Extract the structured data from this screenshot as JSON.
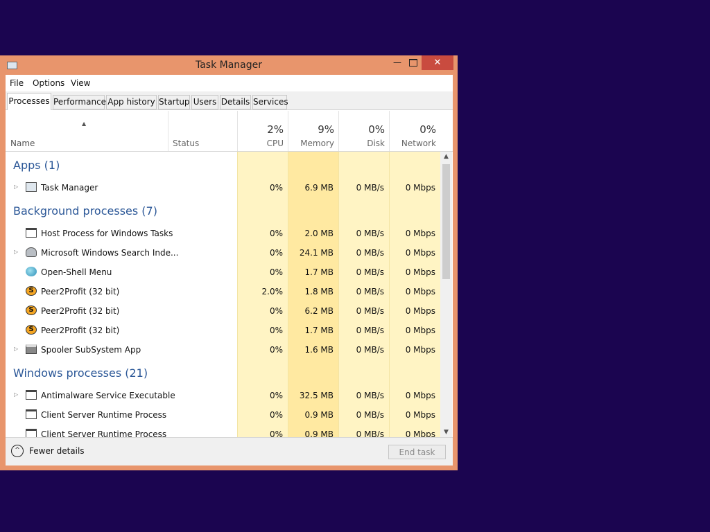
{
  "window": {
    "title": "Task Manager"
  },
  "menu": [
    "File",
    "Options",
    "View"
  ],
  "tabs": [
    "Processes",
    "Performance",
    "App history",
    "Startup",
    "Users",
    "Details",
    "Services"
  ],
  "columns": {
    "name": "Name",
    "status": "Status",
    "cpu": {
      "pct": "2%",
      "label": "CPU"
    },
    "memory": {
      "pct": "9%",
      "label": "Memory"
    },
    "disk": {
      "pct": "0%",
      "label": "Disk"
    },
    "network": {
      "pct": "0%",
      "label": "Network"
    }
  },
  "groups": [
    {
      "title": "Apps (1)",
      "rows": [
        {
          "name": "Task Manager",
          "icon": "task-manager-icon",
          "expandable": true,
          "cpu": "0%",
          "memory": "6.9 MB",
          "disk": "0 MB/s",
          "network": "0 Mbps"
        }
      ]
    },
    {
      "title": "Background processes (7)",
      "rows": [
        {
          "name": "Host Process for Windows Tasks",
          "icon": "window-icon",
          "expandable": false,
          "cpu": "0%",
          "memory": "2.0 MB",
          "disk": "0 MB/s",
          "network": "0 Mbps"
        },
        {
          "name": "Microsoft Windows Search Inde...",
          "icon": "search-indexer-icon",
          "expandable": true,
          "cpu": "0%",
          "memory": "24.1 MB",
          "disk": "0 MB/s",
          "network": "0 Mbps"
        },
        {
          "name": "Open-Shell Menu",
          "icon": "shell-icon",
          "expandable": false,
          "cpu": "0%",
          "memory": "1.7 MB",
          "disk": "0 MB/s",
          "network": "0 Mbps"
        },
        {
          "name": "Peer2Profit (32 bit)",
          "icon": "peer2profit-icon",
          "expandable": false,
          "cpu": "2.0%",
          "memory": "1.8 MB",
          "disk": "0 MB/s",
          "network": "0 Mbps"
        },
        {
          "name": "Peer2Profit (32 bit)",
          "icon": "peer2profit-icon",
          "expandable": false,
          "cpu": "0%",
          "memory": "6.2 MB",
          "disk": "0 MB/s",
          "network": "0 Mbps"
        },
        {
          "name": "Peer2Profit (32 bit)",
          "icon": "peer2profit-icon",
          "expandable": false,
          "cpu": "0%",
          "memory": "1.7 MB",
          "disk": "0 MB/s",
          "network": "0 Mbps"
        },
        {
          "name": "Spooler SubSystem App",
          "icon": "printer-icon",
          "expandable": true,
          "cpu": "0%",
          "memory": "1.6 MB",
          "disk": "0 MB/s",
          "network": "0 Mbps"
        }
      ]
    },
    {
      "title": "Windows processes (21)",
      "rows": [
        {
          "name": "Antimalware Service Executable",
          "icon": "window-icon",
          "expandable": true,
          "cpu": "0%",
          "memory": "32.5 MB",
          "disk": "0 MB/s",
          "network": "0 Mbps"
        },
        {
          "name": "Client Server Runtime Process",
          "icon": "window-icon",
          "expandable": false,
          "cpu": "0%",
          "memory": "0.9 MB",
          "disk": "0 MB/s",
          "network": "0 Mbps"
        },
        {
          "name": "Client Server Runtime Process",
          "icon": "window-icon",
          "expandable": false,
          "cpu": "0%",
          "memory": "0.9 MB",
          "disk": "0 MB/s",
          "network": "0 Mbps"
        }
      ]
    }
  ],
  "footer": {
    "fewer_details": "Fewer details",
    "end_task": "End task"
  },
  "colors": {
    "window_border": "#e8956c",
    "close_button": "#c94b3f",
    "group_title": "#2b5797",
    "heat_light": "#fff4c4",
    "heat_medium": "#ffe9a1",
    "desktop": "#1b0550"
  }
}
